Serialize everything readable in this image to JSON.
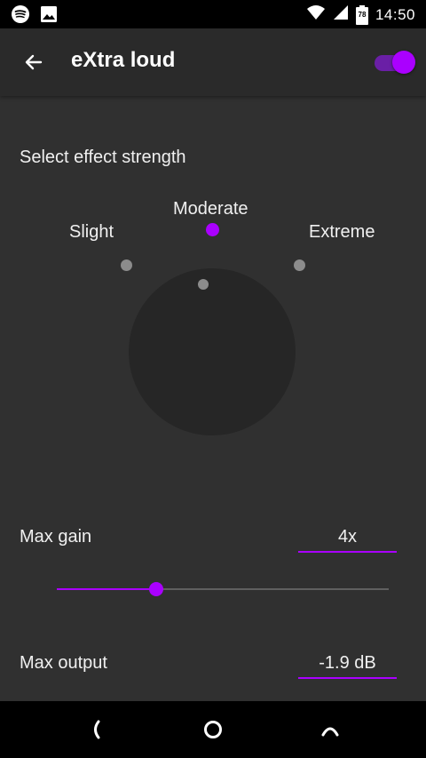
{
  "status_bar": {
    "time": "14:50",
    "battery_level": "78",
    "icons": [
      "spotify-icon",
      "image-icon",
      "wifi-icon",
      "signal-icon",
      "battery-icon"
    ]
  },
  "app_bar": {
    "title": "eXtra loud",
    "toggle_on": true
  },
  "effect_strength": {
    "title": "Select effect strength",
    "options": [
      "Slight",
      "Moderate",
      "Extreme"
    ],
    "selected": "Moderate"
  },
  "max_gain": {
    "label": "Max gain",
    "value": "4x",
    "slider_fraction": 0.3
  },
  "max_output": {
    "label": "Max output",
    "value": "-1.9 dB"
  },
  "colors": {
    "accent": "#aa00ff",
    "background": "#303030",
    "app_bar": "#2a2a2a",
    "knob": "#262626"
  }
}
